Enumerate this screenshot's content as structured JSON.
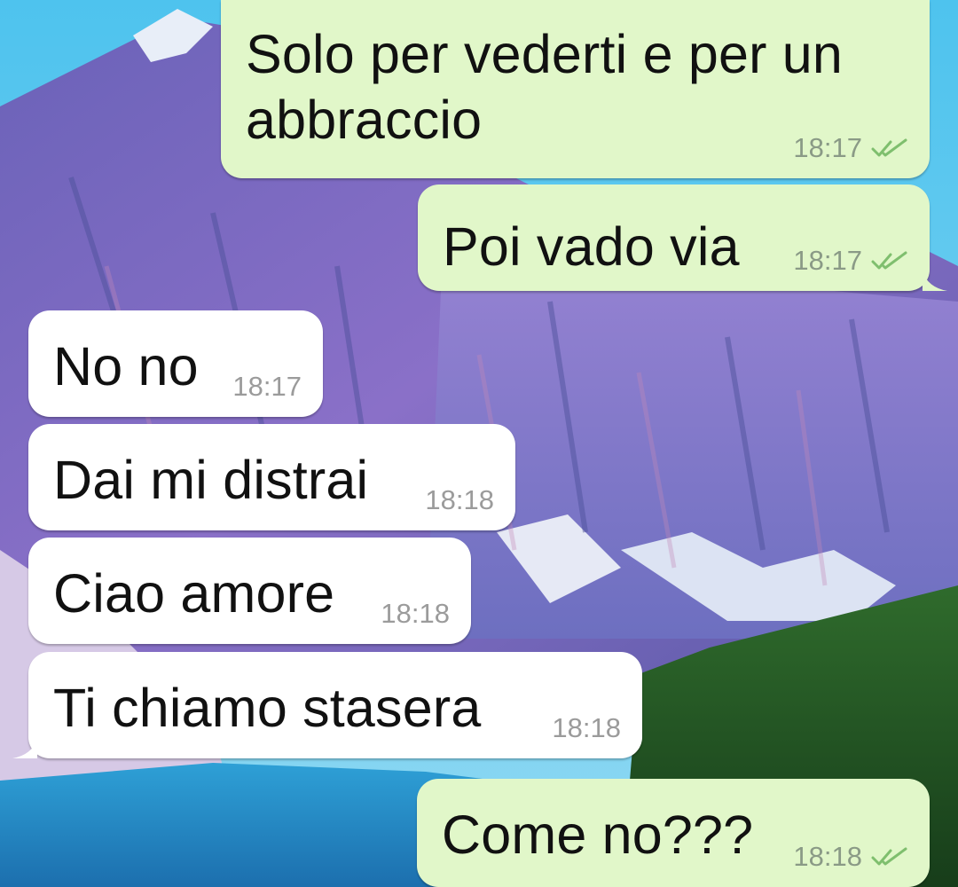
{
  "conversation": {
    "messages": [
      {
        "id": "m1",
        "direction": "outgoing",
        "text": "Solo per vederti e per un\nabbraccio",
        "time": "18:17",
        "read_status": "double-check-read"
      },
      {
        "id": "m2",
        "direction": "outgoing",
        "text": "Poi vado via",
        "time": "18:17",
        "read_status": "double-check-read"
      },
      {
        "id": "m3",
        "direction": "incoming",
        "text": "No no",
        "time": "18:17"
      },
      {
        "id": "m4",
        "direction": "incoming",
        "text": "Dai mi distrai",
        "time": "18:18"
      },
      {
        "id": "m5",
        "direction": "incoming",
        "text": "Ciao amore",
        "time": "18:18"
      },
      {
        "id": "m6",
        "direction": "incoming",
        "text": "Ti chiamo stasera",
        "time": "18:18"
      },
      {
        "id": "m7",
        "direction": "outgoing",
        "text": "Come no???",
        "time": "18:18",
        "read_status": "double-check-read"
      }
    ]
  },
  "colors": {
    "outgoing_bubble": "#e1f7c9",
    "incoming_bubble": "#ffffff",
    "tick": "#7fbf6e",
    "timestamp": "#8a9a86"
  },
  "wallpaper": {
    "description_icon": "mountain-lake-wallpaper"
  }
}
